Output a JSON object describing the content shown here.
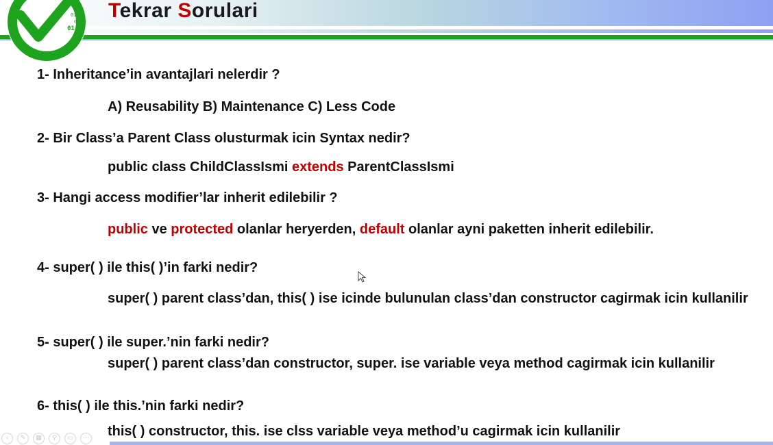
{
  "slide": {
    "title": {
      "letter1": "T",
      "part1": "ekrar ",
      "letter2": "S",
      "part2": "orulari"
    },
    "logo": {
      "icon": "checkmark-circle-icon",
      "binary_lines": [
        "01",
        "01",
        "01",
        "01"
      ]
    },
    "colors": {
      "accent_red": "#c00000",
      "green_rule": "#1ea31e",
      "header_blue": "#8f9ff2"
    },
    "questions": [
      {
        "question": "1- Inheritance’in avantajlari nelerdir ?",
        "answer": [
          "A) Reusability B) Maintenance C) Less Code"
        ]
      },
      {
        "question": "2- Bir Class’a Parent Class olusturmak icin Syntax nedir?",
        "answer": [
          "public class ChildClassIsmi ",
          "extends",
          " ParentClassIsmi"
        ]
      },
      {
        "question": "3- Hangi access modifier’lar inherit edilebilir ?",
        "answer": [
          "public",
          " ve ",
          "protected",
          " olanlar heryerden, ",
          "default",
          " olanlar ayni paketten inherit edilebilir."
        ]
      },
      {
        "question": "4- super( ) ile this( )’in farki nedir?",
        "answer": [
          "super( ) parent class’dan, this( ) ise icinde bulunulan class’dan constructor cagirmak icin kullanilir"
        ]
      },
      {
        "question": "5- super( ) ile super.’nin farki nedir?",
        "answer": [
          "super( ) parent class’dan constructor, super. ise variable veya method cagirmak icin kullanilir"
        ]
      },
      {
        "question": "6- this( ) ile this.’nin farki nedir?",
        "answer": [
          "this( ) constructor, this. ise clss variable veya method’u cagirmak icin kullanilir"
        ]
      }
    ]
  },
  "toolbar": {
    "buttons": [
      "previous-icon",
      "pen-icon",
      "slides-icon",
      "zoom-icon",
      "subtitles-icon",
      "more-icon"
    ]
  }
}
